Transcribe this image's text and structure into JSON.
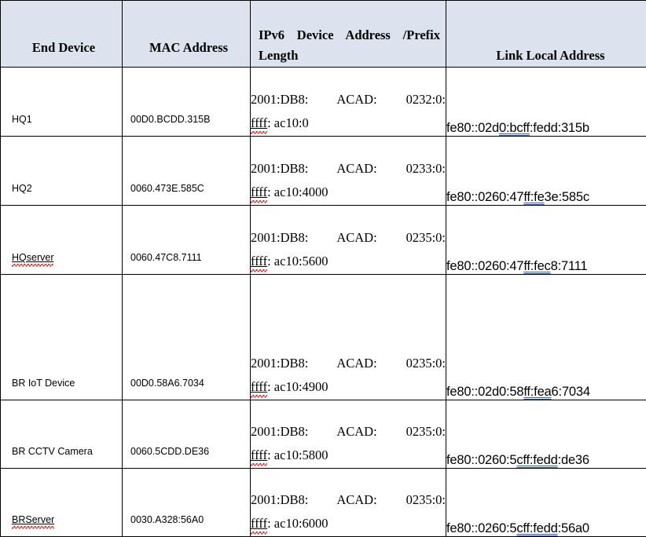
{
  "table": {
    "headers": [
      {
        "key": "end_device",
        "label": "End Device"
      },
      {
        "key": "mac_address",
        "label": "MAC Address"
      },
      {
        "key": "ipv6_prefix",
        "label_line1": "IPv6  Device  Address  /Prefix",
        "label_line2": "Length"
      },
      {
        "key": "link_local",
        "label": "Link Local Address"
      }
    ],
    "rows": [
      {
        "end_device": "HQ1",
        "mac_address": "00D0.BCDD.315B",
        "ipv6_line1": "2001:DB8:   ACAD:   0232:0:",
        "ipv6_ffff": "ffff",
        "ipv6_rest": ": ac10:0",
        "lla_pre": "fe80::02d",
        "lla_eui": "0:bcff",
        "lla_post": ":fedd:315b",
        "device_misspelled": false
      },
      {
        "end_device": "HQ2",
        "mac_address": "0060.473E.585C",
        "ipv6_line1": "2001:DB8:   ACAD:   0233:0:",
        "ipv6_ffff": "ffff",
        "ipv6_rest": ": ac10:4000",
        "lla_pre": "fe80::0260:47",
        "lla_eui": "ff:fe",
        "lla_post": "3e:585c",
        "device_misspelled": false
      },
      {
        "end_device": "HQserver",
        "mac_address": "0060.47C8.7111",
        "ipv6_line1": "2001:DB8:   ACAD:   0235:0:",
        "ipv6_ffff": "ffff",
        "ipv6_rest": ": ac10:5600",
        "lla_pre": "fe80::0260:47",
        "lla_eui": "ff:fec",
        "lla_post": "8:7111",
        "device_misspelled": true
      },
      {
        "end_device": "BR IoT Device",
        "mac_address": "00D0.58A6.7034",
        "ipv6_line1": "2001:DB8:   ACAD:   0235:0:",
        "ipv6_ffff": "ffff",
        "ipv6_rest": ": ac10:4900",
        "lla_pre": "fe80::02d0:58",
        "lla_eui": "ff:fea",
        "lla_post": "6:7034",
        "device_misspelled": false
      },
      {
        "end_device": "BR CCTV Camera",
        "mac_address": "0060.5CDD.DE36",
        "ipv6_line1": "2001:DB8:   ACAD:   0235:0:",
        "ipv6_ffff": "ffff",
        "ipv6_rest": ": ac10:5800",
        "lla_pre": "fe80::0260:5",
        "lla_eui": "cff:fedd",
        "lla_post": ":de36",
        "device_misspelled": false
      },
      {
        "end_device": "BRServer",
        "mac_address": "0030.A328:56A0",
        "ipv6_line1": "2001:DB8:   ACAD:   0235:0:",
        "ipv6_ffff": "ffff",
        "ipv6_rest": ": ac10:6000",
        "lla_pre": "fe80::0260:5",
        "lla_eui": "cff:fedd",
        "lla_post": ":56a0",
        "device_misspelled": true
      }
    ]
  },
  "colors": {
    "header_fill": "#dce3ef",
    "border": "#000000",
    "double_underline": "#2f62c8",
    "spellcheck_squiggle": "#e02020"
  }
}
